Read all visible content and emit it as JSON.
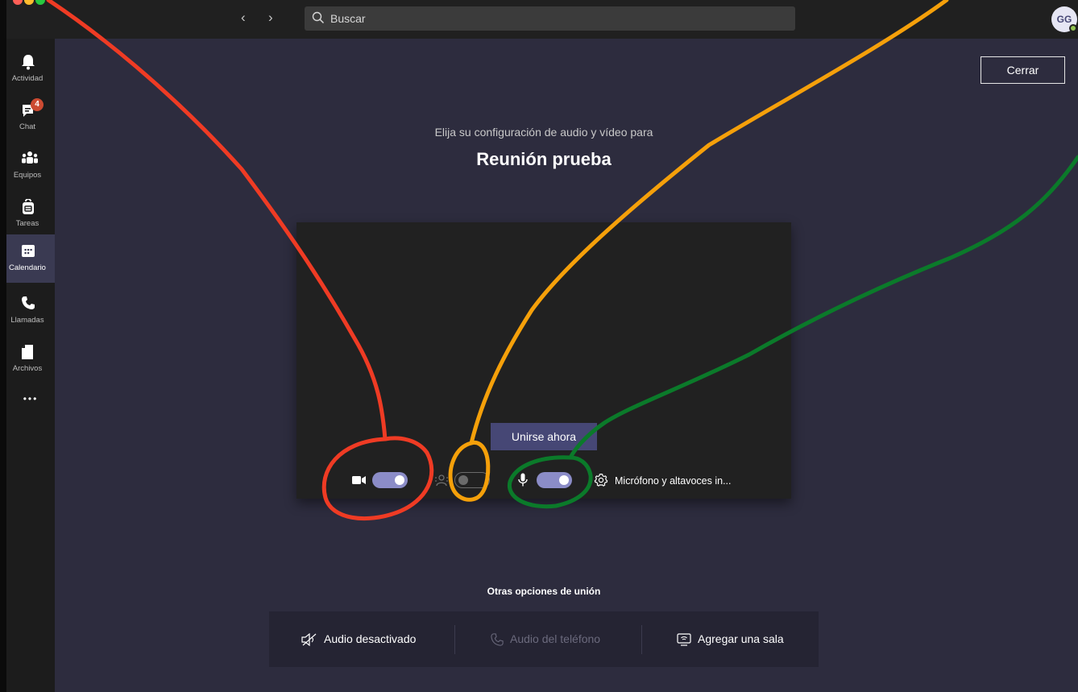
{
  "window": {
    "search_placeholder": "Buscar",
    "back_arrow": "‹",
    "forward_arrow": "›",
    "avatar_initials": "GG"
  },
  "rail": {
    "items": [
      {
        "label": "Actividad",
        "icon": "bell-icon"
      },
      {
        "label": "Chat",
        "icon": "chat-icon",
        "badge": "4"
      },
      {
        "label": "Equipos",
        "icon": "teams-icon"
      },
      {
        "label": "Tareas",
        "icon": "tasks-icon"
      },
      {
        "label": "Calendario",
        "icon": "calendar-icon",
        "active": true
      },
      {
        "label": "Llamadas",
        "icon": "phone-icon"
      },
      {
        "label": "Archivos",
        "icon": "file-icon"
      }
    ],
    "more_label": "•••"
  },
  "main": {
    "close_label": "Cerrar",
    "subtitle": "Elija su configuración de audio y vídeo para",
    "meeting_title": "Reunión prueba",
    "join_label": "Unirse ahora",
    "camera_toggle": "on",
    "background_blur_toggle": "off",
    "mic_toggle": "on",
    "device_label": "Micrófono y altavoces in...",
    "other_options_title": "Otras opciones de unión",
    "other_options": [
      {
        "label": "Audio desactivado",
        "icon": "speaker-off-icon",
        "enabled": true
      },
      {
        "label": "Audio del teléfono",
        "icon": "phone-icon",
        "enabled": false
      },
      {
        "label": "Agregar una sala",
        "icon": "room-icon",
        "enabled": true
      }
    ]
  },
  "colors": {
    "accent": "#464775",
    "toggle_on": "#8b8cc7",
    "badge": "#cc4a31",
    "annotation_red": "#ef3b24",
    "annotation_orange": "#f5a00a",
    "annotation_green": "#0b7a2a"
  }
}
